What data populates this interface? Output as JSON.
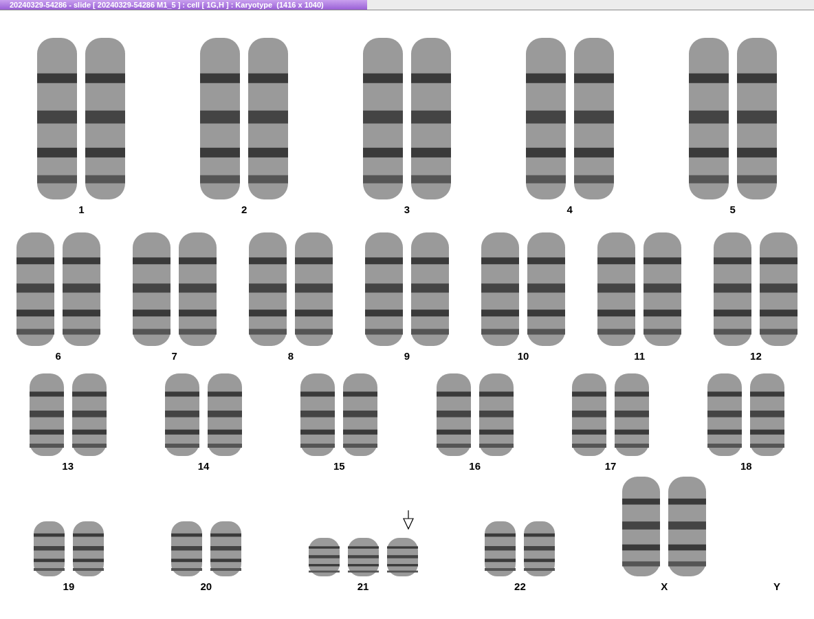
{
  "window": {
    "title": "20240329-54286 - slide [ 20240329-54286 M1_5 ] : cell [ 1G,H ] : Karyotype  (1416 x 1040)"
  },
  "rows": [
    {
      "groups": [
        {
          "label": "1",
          "kind": "pair"
        },
        {
          "label": "2",
          "kind": "pair"
        },
        {
          "label": "3",
          "kind": "pair"
        },
        {
          "label": "4",
          "kind": "pair"
        },
        {
          "label": "5",
          "kind": "pair"
        }
      ]
    },
    {
      "groups": [
        {
          "label": "6",
          "kind": "pair"
        },
        {
          "label": "7",
          "kind": "pair"
        },
        {
          "label": "8",
          "kind": "pair"
        },
        {
          "label": "9",
          "kind": "pair"
        },
        {
          "label": "10",
          "kind": "pair"
        },
        {
          "label": "11",
          "kind": "pair"
        },
        {
          "label": "12",
          "kind": "pair"
        }
      ]
    },
    {
      "groups": [
        {
          "label": "13",
          "kind": "pair"
        },
        {
          "label": "14",
          "kind": "pair"
        },
        {
          "label": "15",
          "kind": "pair"
        },
        {
          "label": "16",
          "kind": "pair"
        },
        {
          "label": "17",
          "kind": "pair"
        },
        {
          "label": "18",
          "kind": "pair"
        }
      ]
    },
    {
      "groups": [
        {
          "label": "19",
          "kind": "pair"
        },
        {
          "label": "20",
          "kind": "pair"
        },
        {
          "label": "21",
          "kind": "trio",
          "arrow": true
        },
        {
          "label": "22",
          "kind": "pair"
        },
        {
          "label": "X",
          "kind": "tall_pair"
        },
        {
          "label": "Y",
          "kind": "none"
        }
      ]
    }
  ]
}
